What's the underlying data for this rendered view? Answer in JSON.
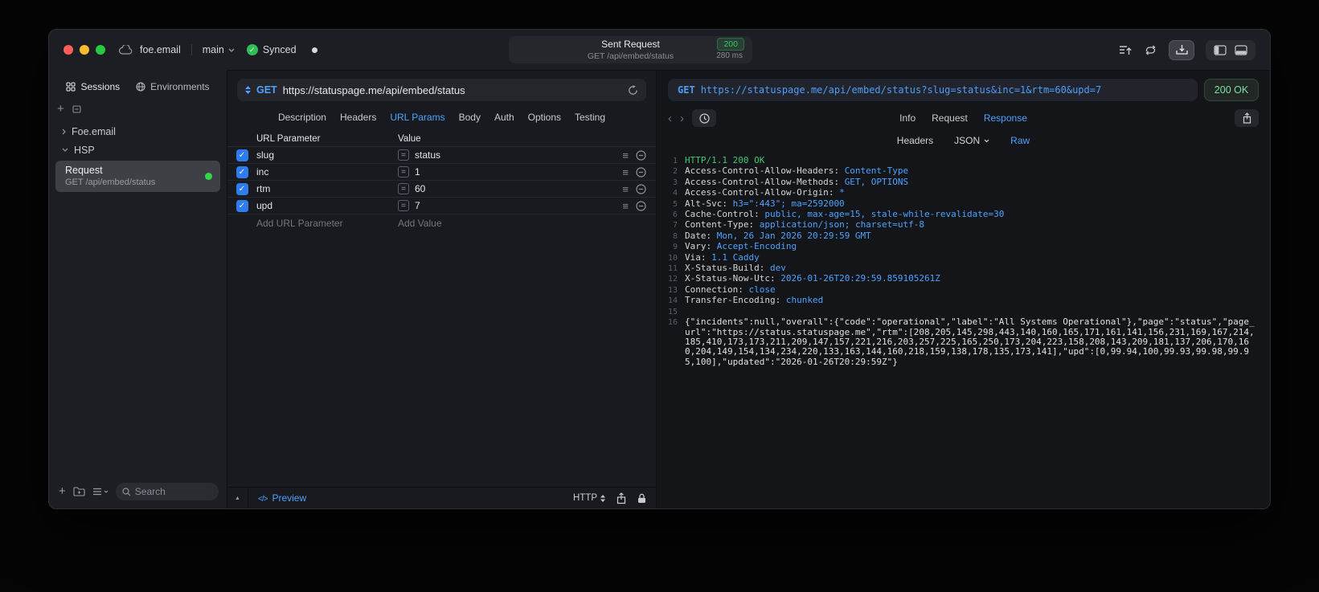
{
  "titlebar": {
    "project": "foe.email",
    "branch": "main",
    "sync": "Synced",
    "request": {
      "title": "Sent Request",
      "status": "200",
      "subtitle": "GET /api/embed/status",
      "duration": "280 ms"
    }
  },
  "sidebar": {
    "tabs": {
      "sessions": "Sessions",
      "environments": "Environments"
    },
    "tree": {
      "foe_email": "Foe.email",
      "hsp": "HSP",
      "request_title": "Request",
      "request_subtitle": "GET /api/embed/status"
    },
    "search_placeholder": "Search"
  },
  "request": {
    "method": "GET",
    "url": "https://statuspage.me/api/embed/status",
    "tabs": [
      "Description",
      "Headers",
      "URL Params",
      "Body",
      "Auth",
      "Options",
      "Testing"
    ],
    "table": {
      "columns": {
        "param": "URL Parameter",
        "value": "Value"
      },
      "rows": [
        {
          "name": "slug",
          "value": "status"
        },
        {
          "name": "inc",
          "value": "1"
        },
        {
          "name": "rtm",
          "value": "60"
        },
        {
          "name": "upd",
          "value": "7"
        }
      ],
      "placeholders": {
        "param": "Add URL Parameter",
        "value": "Add Value"
      }
    },
    "footer": {
      "preview": "Preview",
      "protocol": "HTTP"
    }
  },
  "response": {
    "method": "GET",
    "url": "https://statuspage.me/api/embed/status?slug=status&inc=1&rtm=60&upd=7",
    "status": "200 OK",
    "tabs": [
      "Info",
      "Request",
      "Response"
    ],
    "subtabs": {
      "headers": "Headers",
      "json": "JSON",
      "raw": "Raw"
    },
    "raw": {
      "lines": [
        {
          "n": "1",
          "text": "HTTP/1.1 200 OK"
        },
        {
          "n": "2",
          "key": "Access-Control-Allow-Headers",
          "value": "Content-Type"
        },
        {
          "n": "3",
          "key": "Access-Control-Allow-Methods",
          "value": "GET, OPTIONS"
        },
        {
          "n": "4",
          "key": "Access-Control-Allow-Origin",
          "value": "*"
        },
        {
          "n": "5",
          "key": "Alt-Svc",
          "value": "h3=\":443\"; ma=2592000"
        },
        {
          "n": "6",
          "key": "Cache-Control",
          "value": "public, max-age=15, stale-while-revalidate=30"
        },
        {
          "n": "7",
          "key": "Content-Type",
          "value": "application/json; charset=utf-8"
        },
        {
          "n": "8",
          "key": "Date",
          "value": "Mon, 26 Jan 2026 20:29:59 GMT"
        },
        {
          "n": "9",
          "key": "Vary",
          "value": "Accept-Encoding"
        },
        {
          "n": "10",
          "key": "Via",
          "value": "1.1 Caddy"
        },
        {
          "n": "11",
          "key": "X-Status-Build",
          "value": "dev"
        },
        {
          "n": "12",
          "key": "X-Status-Now-Utc",
          "value": "2026-01-26T20:29:59.859105261Z"
        },
        {
          "n": "13",
          "key": "Connection",
          "value": "close"
        },
        {
          "n": "14",
          "key": "Transfer-Encoding",
          "value": "chunked"
        },
        {
          "n": "15",
          "text": ""
        },
        {
          "n": "16",
          "text": "{\"incidents\":null,\"overall\":{\"code\":\"operational\",\"label\":\"All Systems Operational\"},\"page\":\"status\",\"page_url\":\"https://status.statuspage.me\",\"rtm\":[208,205,145,298,443,140,160,165,171,161,141,156,231,169,167,214,185,410,173,173,211,209,147,157,221,216,203,257,225,165,250,173,204,223,158,208,143,209,181,137,206,170,160,204,149,154,134,234,220,133,163,144,160,218,159,138,178,135,173,141],\"upd\":[0,99.94,100,99.93,99.98,99.95,100],\"updated\":\"2026-01-26T20:29:59Z\"}"
        }
      ]
    }
  }
}
